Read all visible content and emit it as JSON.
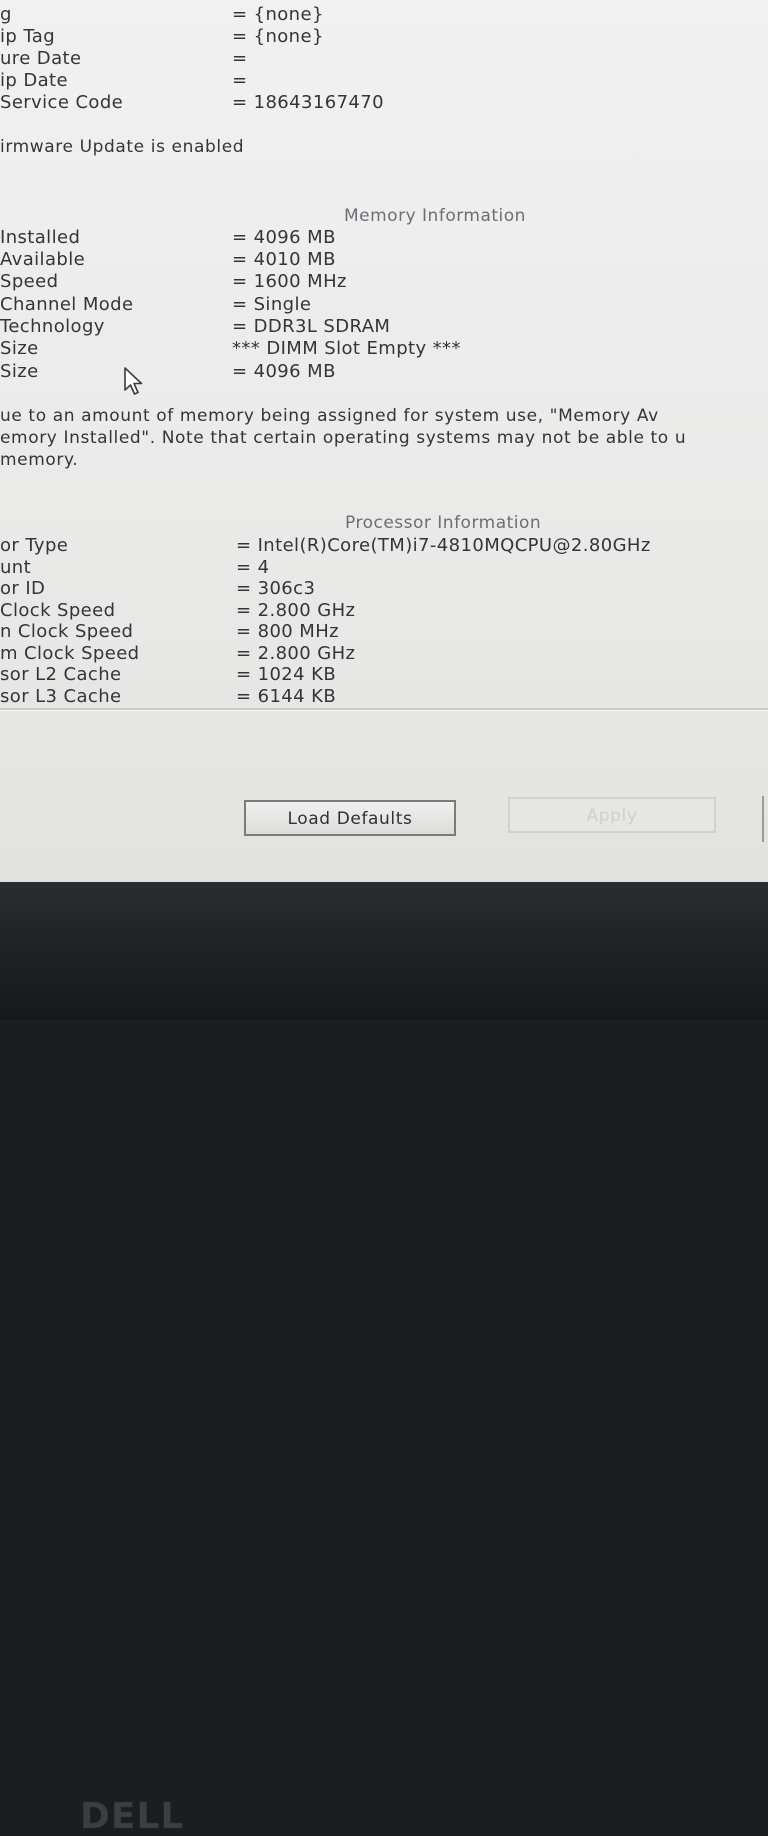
{
  "sysinfo": [
    {
      "label": "g",
      "value": "= {none}"
    },
    {
      "label": "ip Tag",
      "value": "= {none}"
    },
    {
      "label": "ure Date",
      "value": "="
    },
    {
      "label": "ip Date",
      "value": "="
    },
    {
      "label": "Service Code",
      "value": "= 18643167470"
    }
  ],
  "firmware_note": "irmware Update is enabled",
  "memory": {
    "heading": "Memory Information",
    "rows": [
      {
        "label": "Installed",
        "value": "= 4096 MB"
      },
      {
        "label": "Available",
        "value": "= 4010 MB"
      },
      {
        "label": "Speed",
        "value": "= 1600 MHz"
      },
      {
        "label": "Channel Mode",
        "value": "= Single"
      },
      {
        "label": "Technology",
        "value": "= DDR3L SDRAM"
      },
      {
        "label": "Size",
        "value": "*** DIMM Slot Empty ***"
      },
      {
        "label": "Size",
        "value": "= 4096 MB"
      }
    ],
    "note_lines": [
      "ue to an amount of memory being assigned for system use, \"Memory Av",
      "emory Installed\". Note that certain operating systems may not be able to u",
      " memory."
    ]
  },
  "processor": {
    "heading": "Processor Information",
    "rows": [
      {
        "label": "or Type",
        "value": "= Intel(R)Core(TM)i7-4810MQCPU@2.80GHz"
      },
      {
        "label": "unt",
        "value": "= 4"
      },
      {
        "label": "or ID",
        "value": "= 306c3"
      },
      {
        "label": "Clock Speed",
        "value": "= 2.800 GHz"
      },
      {
        "label": "n Clock Speed",
        "value": "= 800 MHz"
      },
      {
        "label": "m Clock Speed",
        "value": "= 2.800 GHz"
      },
      {
        "label": "sor L2 Cache",
        "value": "= 1024 KB"
      },
      {
        "label": "sor L3 Cache",
        "value": "= 6144 KB"
      }
    ]
  },
  "buttons": {
    "load_defaults": "Load Defaults",
    "apply": "Apply"
  },
  "bezel": {
    "logo": "DELL"
  }
}
